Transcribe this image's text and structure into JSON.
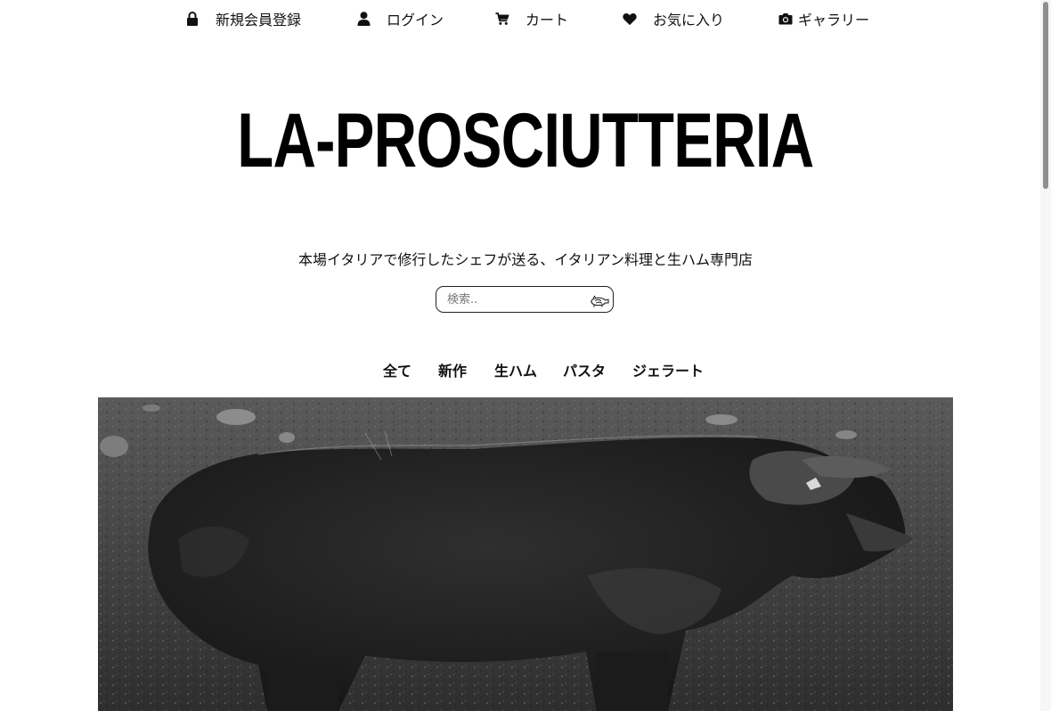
{
  "top_nav": {
    "register_label": "新規会員登録",
    "login_label": "ログイン",
    "cart_label": "カート",
    "favorites_label": "お気に入り",
    "gallery_label": "ギャラリー"
  },
  "brand": {
    "title": "LA-PROSCIUTTERIA"
  },
  "tagline": "本場イタリアで修行したシェフが送る、イタリアン料理と生ハム専門店",
  "search": {
    "placeholder": "検索..",
    "value": ""
  },
  "categories": [
    {
      "label": "全て"
    },
    {
      "label": "新作"
    },
    {
      "label": "生ハム"
    },
    {
      "label": "パスタ"
    },
    {
      "label": "ジェラート"
    }
  ],
  "hero": {
    "subject": "pig-photo"
  },
  "colors": {
    "text": "#111111",
    "background": "#ffffff",
    "brand": "#000000"
  }
}
